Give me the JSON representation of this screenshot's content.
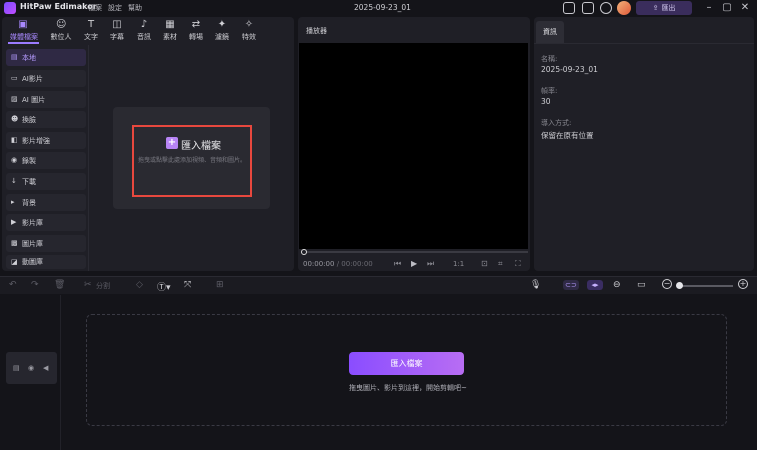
{
  "titlebar": {
    "app_name": "HitPaw Edimakor",
    "menus": [
      "檔案",
      "設定",
      "幫助"
    ],
    "doc_title": "2025-09-23_01",
    "export_label": "匯出"
  },
  "toolbar": {
    "tools": [
      {
        "label": "媒體檔案",
        "icon": "folder-icon"
      },
      {
        "label": "數位人",
        "icon": "person-icon"
      },
      {
        "label": "文字",
        "icon": "text-icon"
      },
      {
        "label": "字幕",
        "icon": "caption-icon"
      },
      {
        "label": "音訊",
        "icon": "music-icon"
      },
      {
        "label": "素材",
        "icon": "grid-icon"
      },
      {
        "label": "轉場",
        "icon": "transition-icon"
      },
      {
        "label": "濾鏡",
        "icon": "filter-icon"
      },
      {
        "label": "特效",
        "icon": "effect-icon"
      }
    ]
  },
  "sidebar": {
    "items": [
      {
        "label": "本地",
        "icon": "folder-icon"
      },
      {
        "label": "AI影片",
        "icon": "ai-video-icon"
      },
      {
        "label": "AI 圖片",
        "icon": "ai-image-icon"
      },
      {
        "label": "換臉",
        "icon": "face-swap-icon"
      },
      {
        "label": "影片增強",
        "icon": "enhance-icon"
      },
      {
        "label": "錄製",
        "icon": "record-icon"
      },
      {
        "label": "下載",
        "icon": "download-icon"
      },
      {
        "label": "背景",
        "icon": "background-icon"
      },
      {
        "label": "影片庫",
        "icon": "video-library-icon"
      },
      {
        "label": "圖片庫",
        "icon": "image-library-icon"
      },
      {
        "label": "動圖庫",
        "icon": "gif-library-icon"
      }
    ]
  },
  "import": {
    "label": "匯入檔案",
    "hint": "拖曳或點擊此處添加視頻、音頻和圖片。"
  },
  "player": {
    "title": "播放器",
    "current_time": "00:00:00",
    "total_time": "00:00:00",
    "ratio": "1:1"
  },
  "info": {
    "tab": "資訊",
    "fields": [
      {
        "key": "名稱:",
        "value": "2025-09-23_01"
      },
      {
        "key": "幀率:",
        "value": "30"
      },
      {
        "key": "導入方式:",
        "value": "保留在原有位置"
      }
    ]
  },
  "timeline": {
    "split_label": "分割",
    "drop_button": "匯入檔案",
    "drop_hint": "拖曳圖片、影片到這裡，開始剪輯吧~"
  }
}
